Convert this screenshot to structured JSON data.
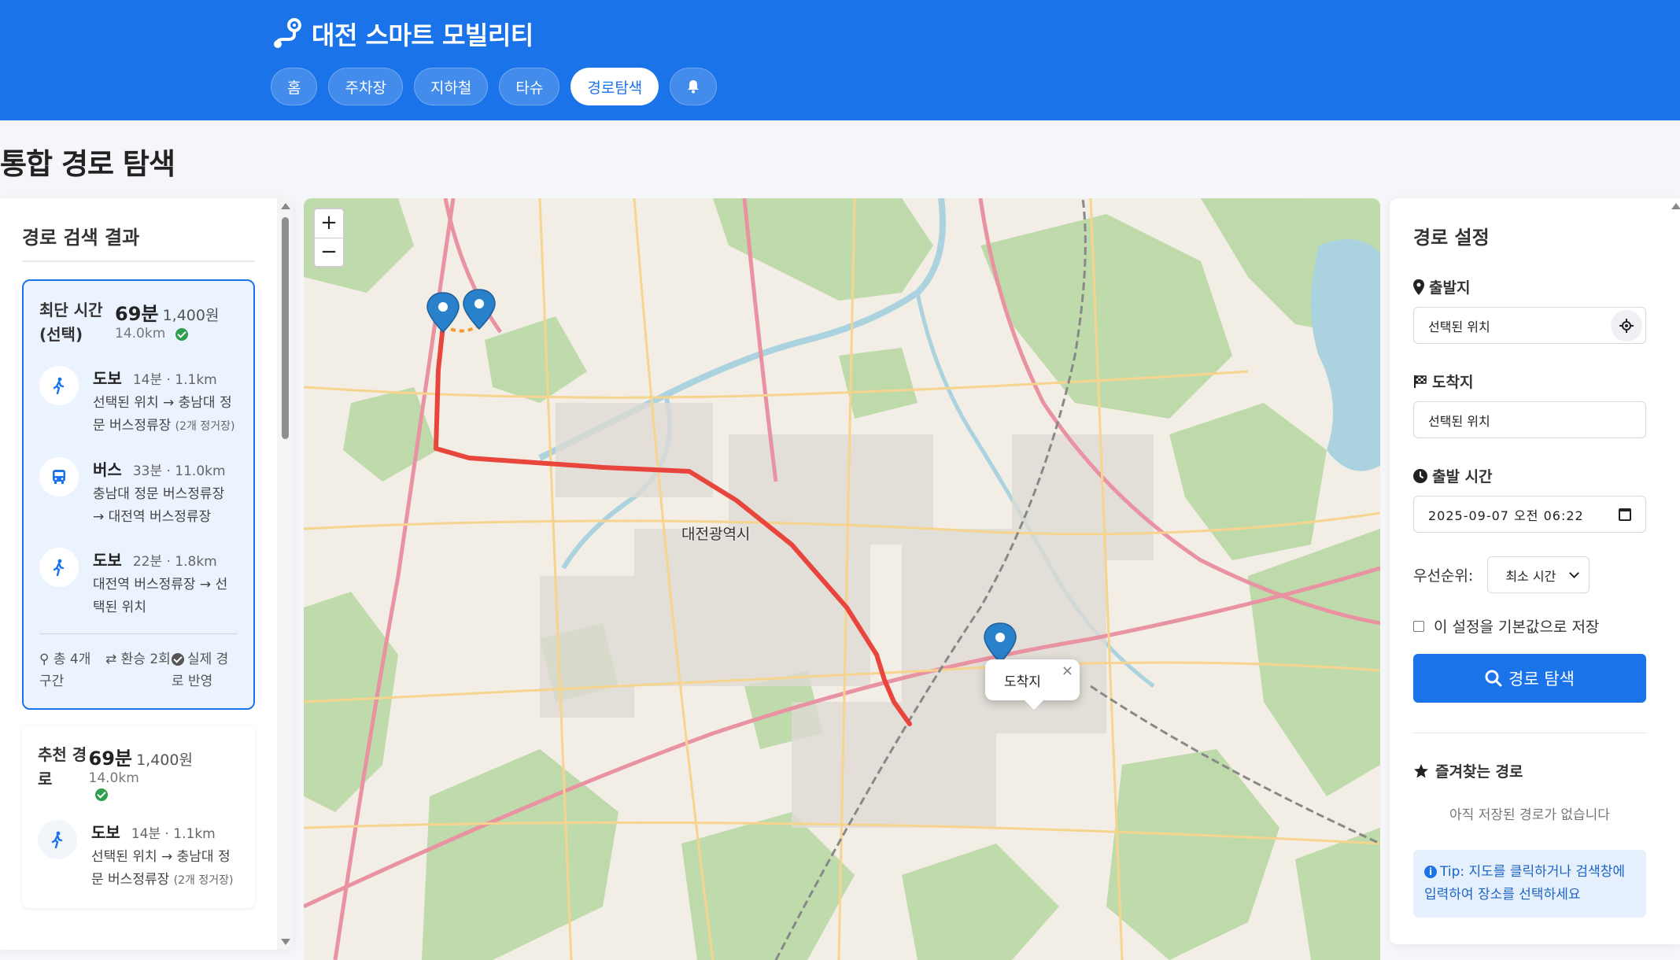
{
  "header": {
    "title": "대전 스마트 모빌리티",
    "nav": [
      {
        "label": "홈",
        "active": false
      },
      {
        "label": "주차장",
        "active": false
      },
      {
        "label": "지하철",
        "active": false
      },
      {
        "label": "타슈",
        "active": false
      },
      {
        "label": "경로탐색",
        "active": true
      }
    ],
    "bell_icon": "bell-icon"
  },
  "page": {
    "title": "통합 경로 탐색"
  },
  "results": {
    "heading": "경로 검색 결과",
    "routes": [
      {
        "label": "최단 시간 (선택)",
        "time": "69분",
        "fare": "1,400원",
        "distance": "14.0km",
        "selected": true,
        "legs": [
          {
            "mode": "도보",
            "icon": "walk-icon",
            "meta": "14분 · 1.1km",
            "desc": "선택된 위치 → 충남대 정문 버스정류장",
            "note": "(2개 정거장)"
          },
          {
            "mode": "버스",
            "icon": "bus-icon",
            "meta": "33분 · 11.0km",
            "desc": "충남대 정문 버스정류장 → 대전역 버스정류장",
            "note": ""
          },
          {
            "mode": "도보",
            "icon": "walk-icon",
            "meta": "22분 · 1.8km",
            "desc": "대전역 버스정류장 → 선택된 위치",
            "note": ""
          }
        ],
        "footer": {
          "segments": "총 4개 구간",
          "transfers": "환승 2회",
          "realtime": "실제 경로 반영"
        }
      },
      {
        "label": "추천 경로",
        "time": "69분",
        "fare": "1,400원",
        "distance": "14.0km",
        "selected": false,
        "legs": [
          {
            "mode": "도보",
            "icon": "walk-icon",
            "meta": "14분 · 1.1km",
            "desc": "선택된 위치 → 충남대 정문 버스정류장",
            "note": "(2개 정거장)"
          }
        ]
      }
    ]
  },
  "map": {
    "zoom_in": "+",
    "zoom_out": "−",
    "city_label": "대전광역시",
    "popup": {
      "text": "도착지",
      "close": "×"
    },
    "route_color": "#e8453c",
    "marker_color": "#2a81cb"
  },
  "settings": {
    "heading": "경로 설정",
    "origin_label": "출발지",
    "origin_value": "선택된 위치",
    "dest_label": "도착지",
    "dest_value": "선택된 위치",
    "time_label": "출발 시간",
    "time_value": "2025-09-07  오전  06:22",
    "priority_label": "우선순위:",
    "priority_value": "최소 시간",
    "save_default_label": "이 설정을 기본값으로 저장",
    "search_button": "경로 탐색",
    "favorites_title": "즐겨찾는 경로",
    "favorites_empty": "아직 저장된 경로가 없습니다",
    "tip": "Tip: 지도를 클릭하거나 검색창에 입력하여 장소를 선택하세요"
  },
  "colors": {
    "primary": "#1a73e8",
    "success": "#2e9e4f",
    "route": "#e8453c"
  }
}
